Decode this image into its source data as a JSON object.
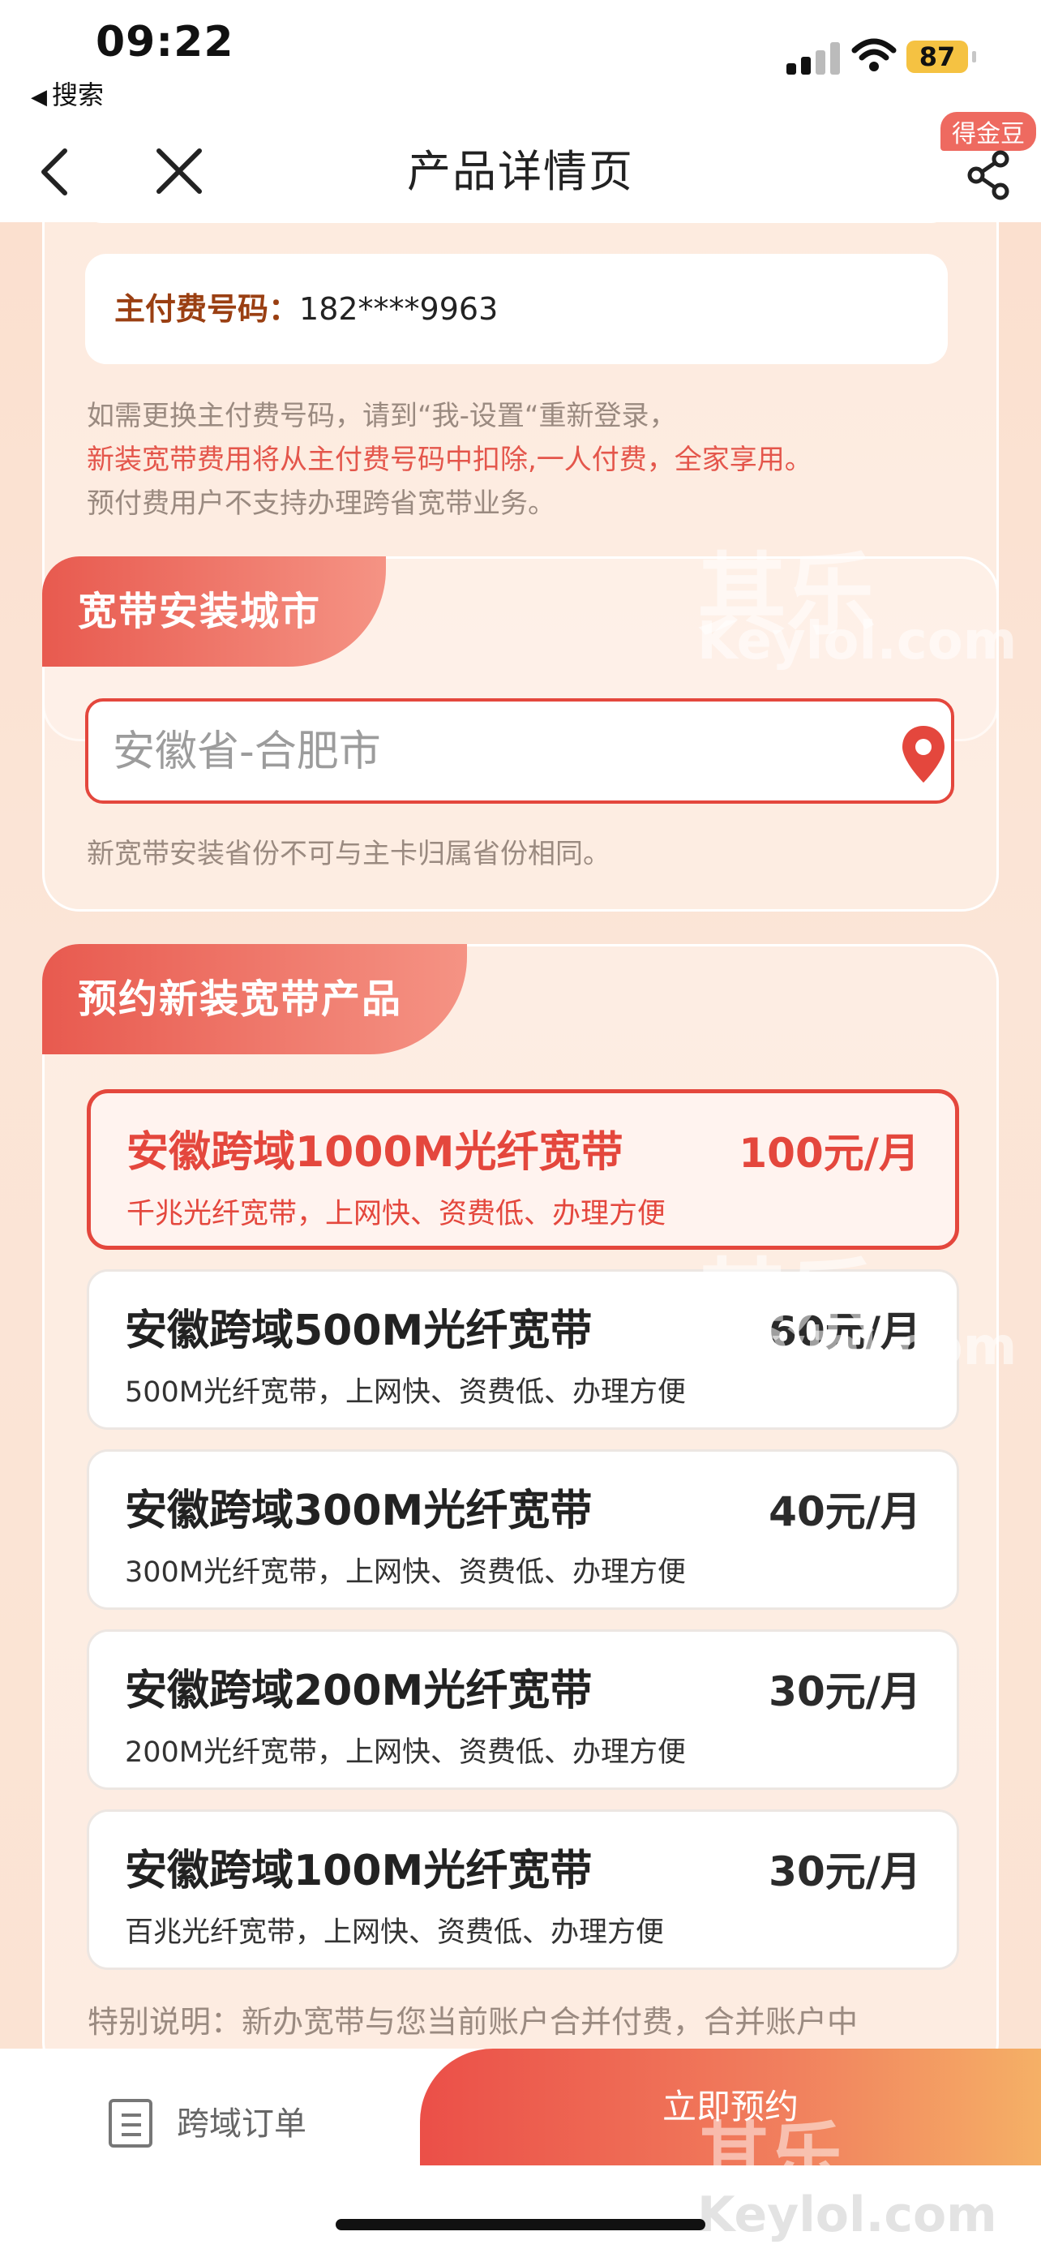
{
  "status_bar": {
    "time": "09:22",
    "back_app_label": "搜索",
    "battery": "87"
  },
  "nav": {
    "title": "产品详情页",
    "badge": "得金豆"
  },
  "payer": {
    "label": "主付费号码：",
    "number": "182****9963",
    "notes": [
      "如需更换主付费号码，请到“我-设置“重新登录，",
      "新装宽带费用将从主付费号码中扣除,一人付费，全家享用。",
      "预付费用户不支持办理跨省宽带业务。"
    ]
  },
  "city_section": {
    "title": "宽带安装城市",
    "placeholder": "安徽省-合肥市",
    "note": "新宽带安装省份不可与主卡归属省份相同。"
  },
  "products_section": {
    "title": "预约新装宽带产品",
    "items": [
      {
        "name": "安徽跨域1000M光纤宽带",
        "desc": "千兆光纤宽带，上网快、资费低、办理方便",
        "price": "100元/月",
        "selected": true
      },
      {
        "name": "安徽跨域500M光纤宽带",
        "desc": "500M光纤宽带，上网快、资费低、办理方便",
        "price": "60元/月",
        "selected": false
      },
      {
        "name": "安徽跨域300M光纤宽带",
        "desc": "300M光纤宽带，上网快、资费低、办理方便",
        "price": "40元/月",
        "selected": false
      },
      {
        "name": "安徽跨域200M光纤宽带",
        "desc": "200M光纤宽带，上网快、资费低、办理方便",
        "price": "30元/月",
        "selected": false
      },
      {
        "name": "安徽跨域100M光纤宽带",
        "desc": "百兆光纤宽带，上网快、资费低、办理方便",
        "price": "30元/月",
        "selected": false
      }
    ],
    "special_note": "特别说明：新办宽带与您当前账户合并付费，合并账户中"
  },
  "bottom": {
    "order_label": "跨域订单",
    "book_label": "立即预约"
  },
  "watermark": {
    "cn": "其乐",
    "en": "Keylol.com"
  },
  "colors": {
    "accent": "#e4473d",
    "brown": "#9a3f12",
    "note_gray": "#9a8a80"
  }
}
